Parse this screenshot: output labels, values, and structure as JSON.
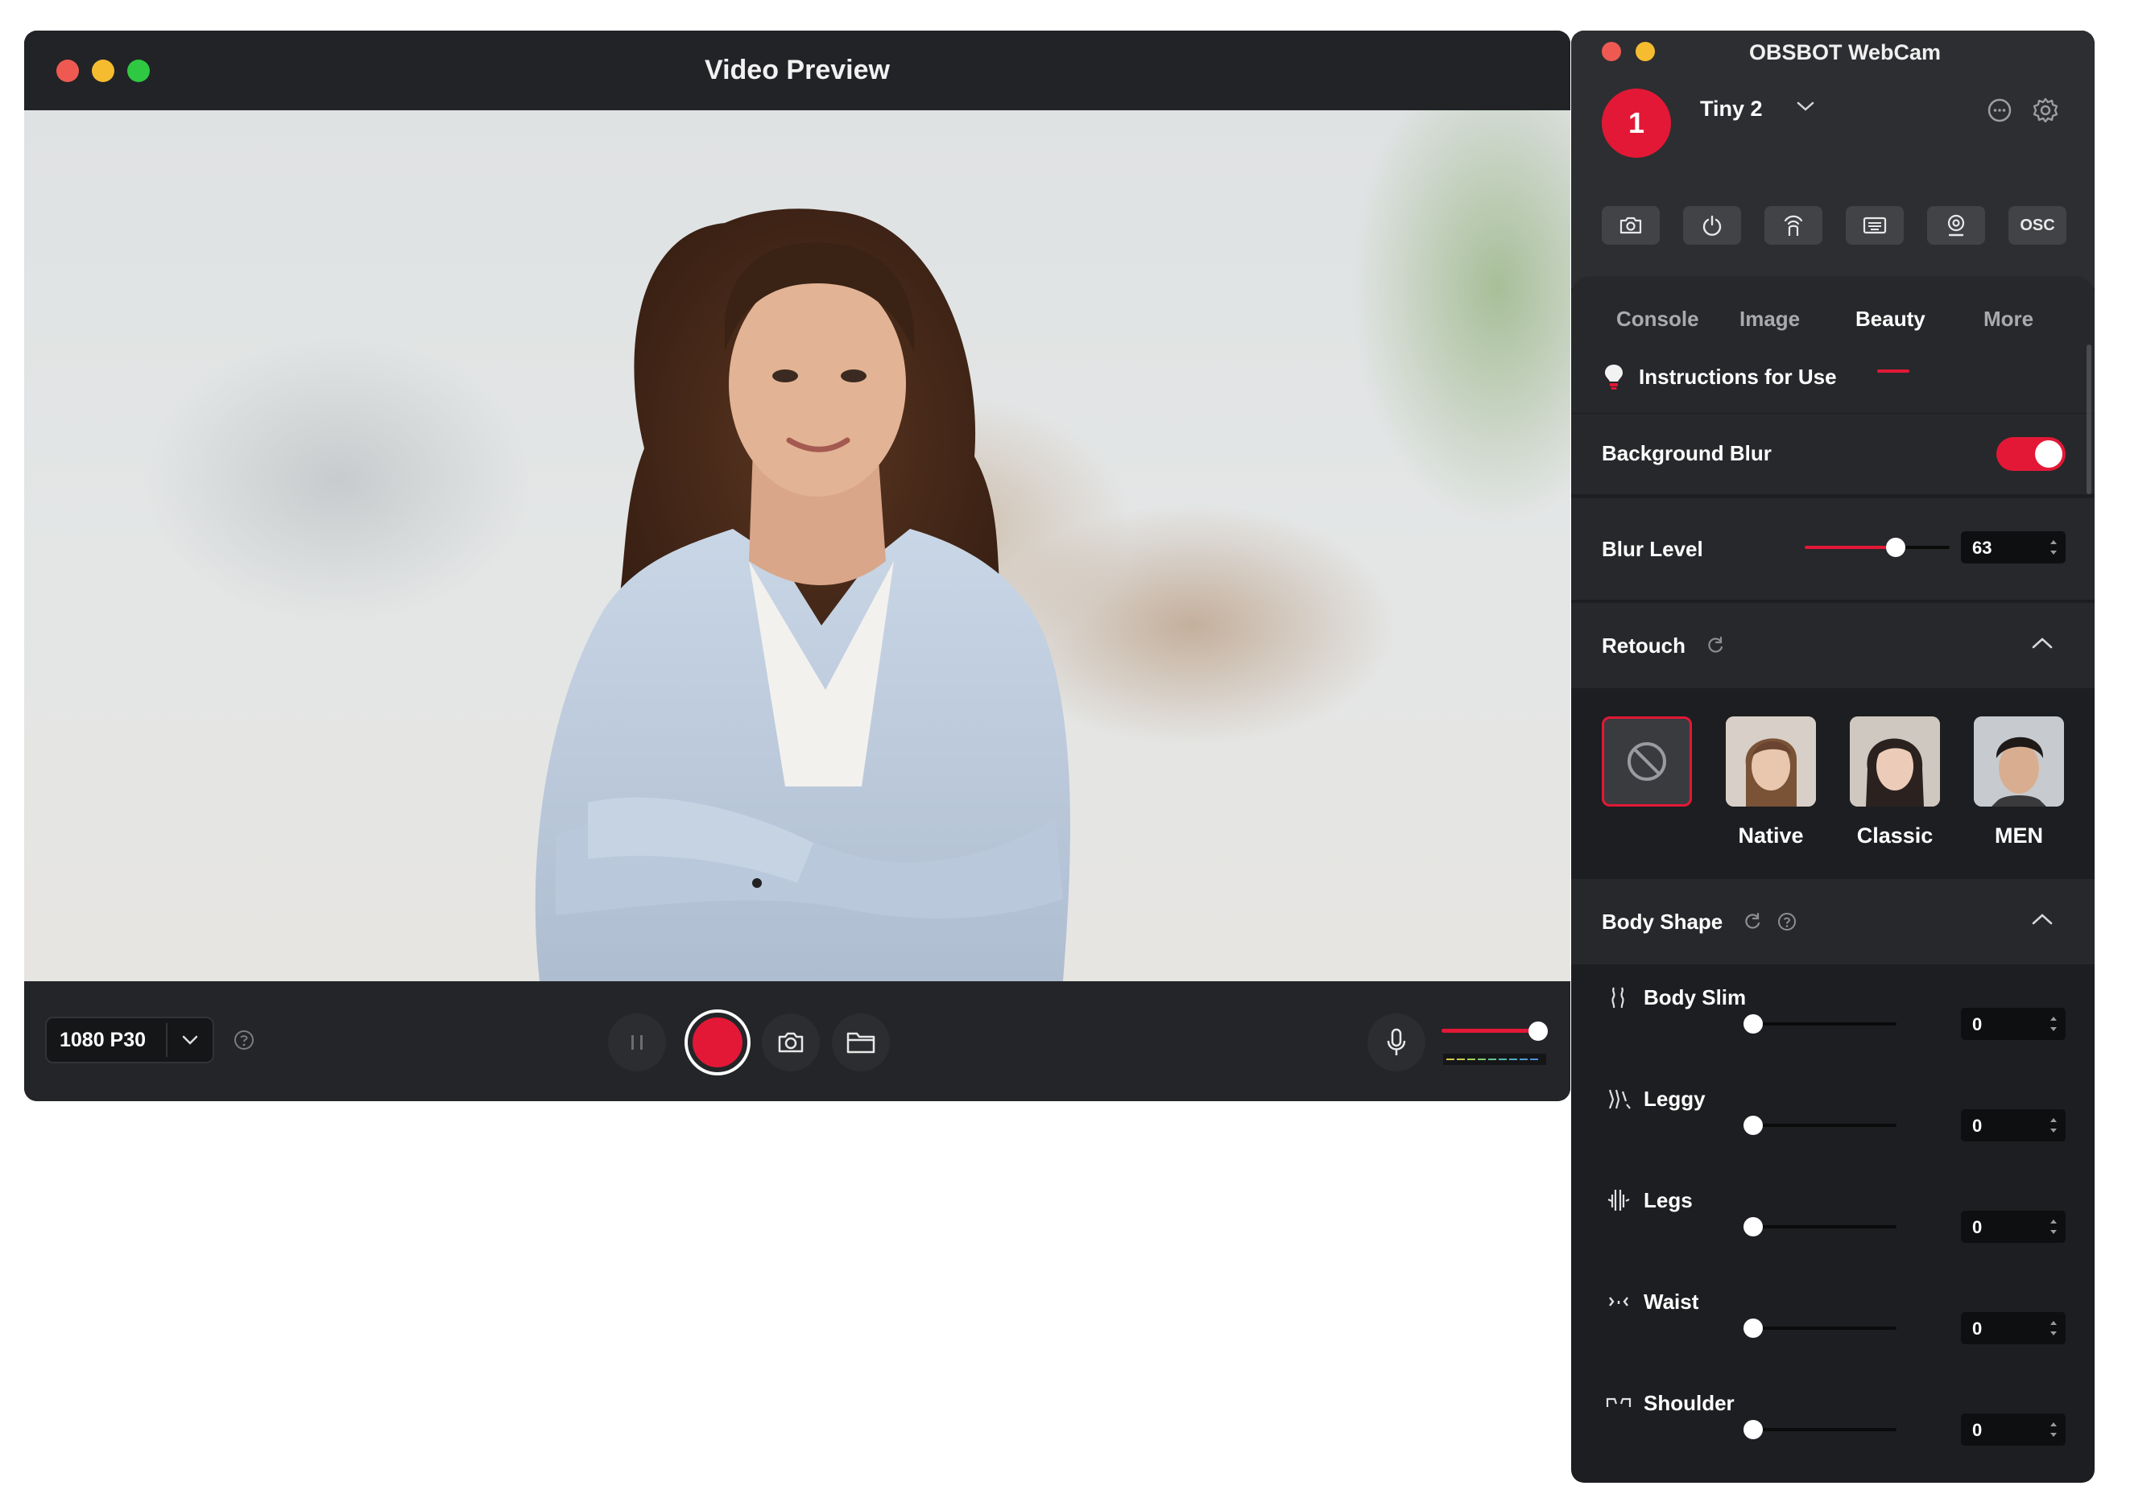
{
  "preview_window": {
    "title": "Video Preview",
    "resolution": "1080 P30",
    "volume_level": 0.92
  },
  "panel": {
    "title": "OBSBOT WebCam",
    "device_number": "1",
    "device_name": "Tiny 2",
    "toolbar": {
      "osc_label": "OSC"
    },
    "tabs": [
      {
        "label": "Console",
        "active": false
      },
      {
        "label": "Image",
        "active": false
      },
      {
        "label": "Beauty",
        "active": true
      },
      {
        "label": "More",
        "active": false
      }
    ],
    "instructions": "Instructions for Use",
    "background_blur": {
      "label": "Background Blur",
      "enabled": true
    },
    "blur_level": {
      "label": "Blur Level",
      "value": "63",
      "max": 100
    },
    "retouch": {
      "label": "Retouch",
      "presets": [
        {
          "label": "Native"
        },
        {
          "label": "Classic"
        },
        {
          "label": "MEN"
        }
      ]
    },
    "body_shape": {
      "label": "Body Shape",
      "items": [
        {
          "label": "Body Slim",
          "value": "0"
        },
        {
          "label": "Leggy",
          "value": "0"
        },
        {
          "label": "Legs",
          "value": "0"
        },
        {
          "label": "Waist",
          "value": "0"
        },
        {
          "label": "Shoulder",
          "value": "0"
        }
      ]
    }
  },
  "colors": {
    "accent": "#e31836",
    "panel_bg": "#1d1e21",
    "section_bg": "#27282b"
  }
}
